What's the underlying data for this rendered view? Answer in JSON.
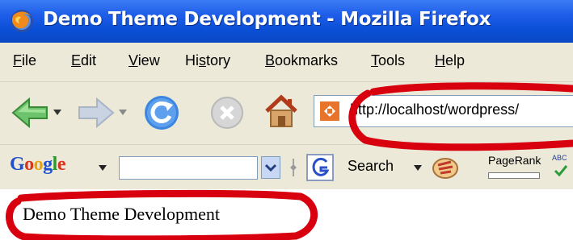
{
  "window": {
    "title": "Demo Theme Development - Mozilla Firefox",
    "app_icon": "firefox-logo"
  },
  "menubar": {
    "items": [
      {
        "label": "File",
        "hotkey": "F",
        "rest": "ile"
      },
      {
        "label": "Edit",
        "hotkey": "E",
        "rest": "dit"
      },
      {
        "label": "View",
        "hotkey": "V",
        "rest": "iew"
      },
      {
        "label": "History",
        "pre": "Hi",
        "hotkey": "s",
        "rest": "tory"
      },
      {
        "label": "Bookmarks",
        "hotkey": "B",
        "rest": "ookmarks"
      },
      {
        "label": "Tools",
        "hotkey": "T",
        "rest": "ools"
      },
      {
        "label": "Help",
        "hotkey": "H",
        "rest": "elp"
      }
    ]
  },
  "navbar": {
    "icons": [
      "back-arrow-icon",
      "forward-arrow-icon",
      "reload-icon",
      "stop-icon",
      "home-icon",
      "page-favicon"
    ],
    "url": "http://localhost/wordpress/"
  },
  "googlebar": {
    "logo": "Google",
    "search_value": "",
    "search_button": "Search",
    "pagerank_label": "PageRank",
    "spellcheck_label": "ABC"
  },
  "page": {
    "site_title": "Demo Theme Development"
  },
  "colors": {
    "titlebar": "#0a4fd6",
    "toolbar": "#ece9d8",
    "annotation": "#d8000f"
  }
}
